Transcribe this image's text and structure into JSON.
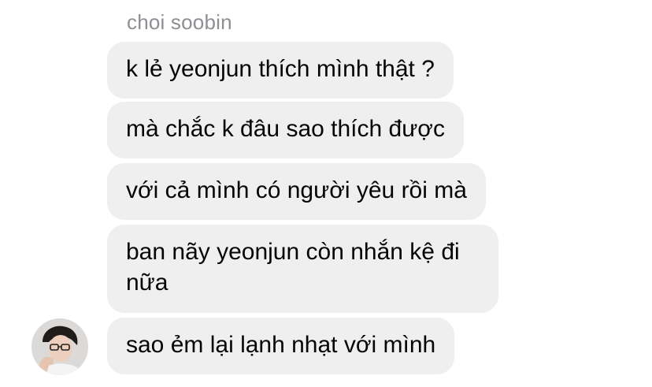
{
  "chat": {
    "sender_name": "choi soobin",
    "messages": [
      {
        "text": "k lẻ yeonjun thích mình thật ?"
      },
      {
        "text": "mà chắc k đâu sao thích được"
      },
      {
        "text": "với cả mình có người yêu rồi mà"
      },
      {
        "text": "ban nãy yeonjun còn nhắn kệ đi nữa"
      },
      {
        "text": "sao ẻm lại lạnh nhạt với mình"
      }
    ]
  },
  "colors": {
    "bubble_bg": "#efefef",
    "sender_name": "#8e8e93",
    "text": "#050505"
  },
  "icons": {
    "avatar": "profile-photo-icon"
  }
}
